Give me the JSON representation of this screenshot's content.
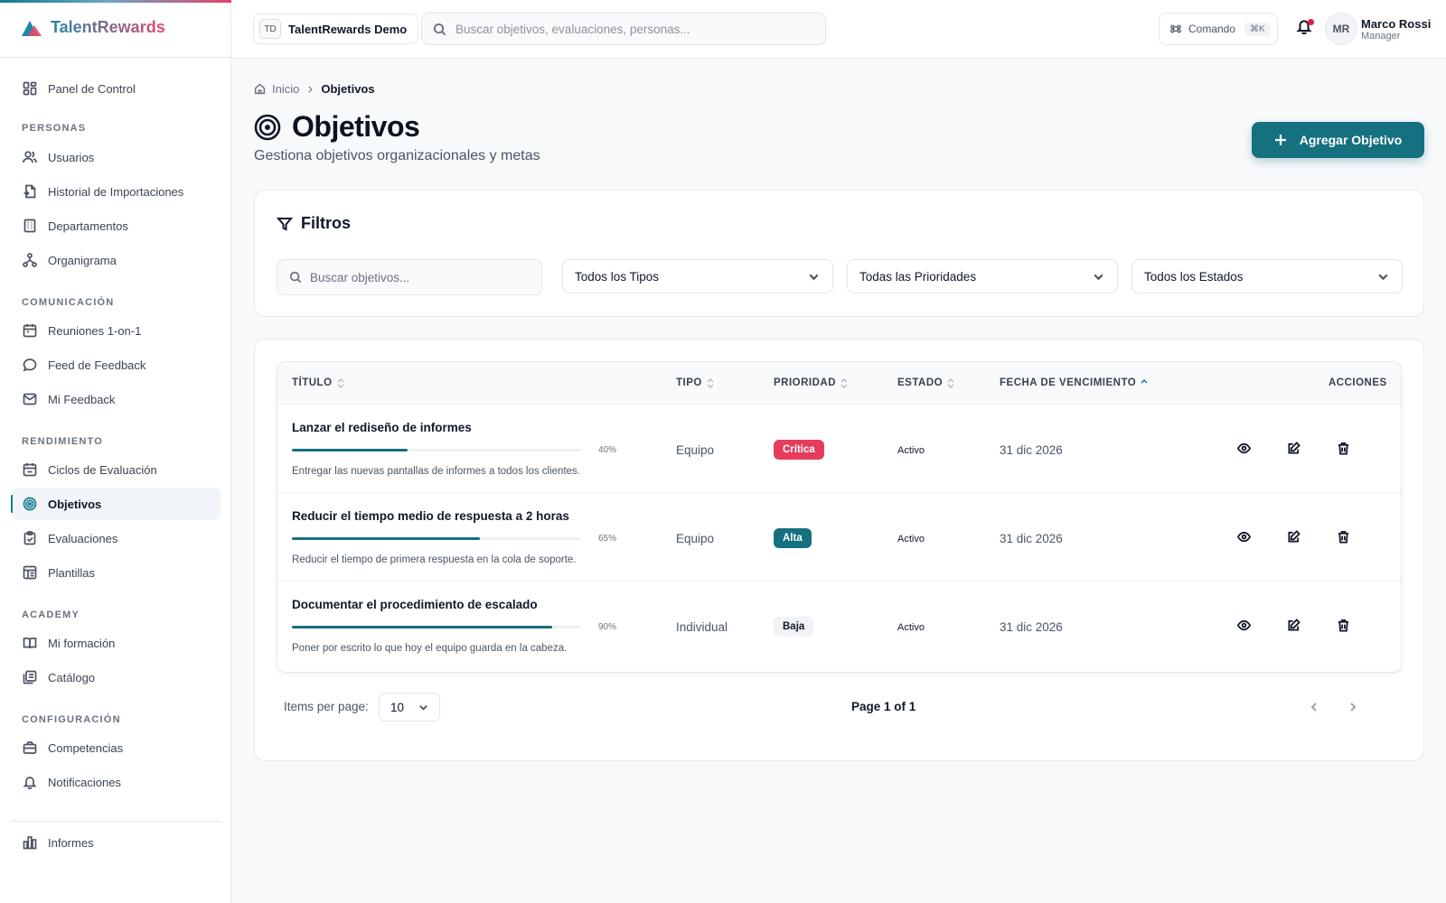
{
  "brand": {
    "name": "TalentRewards"
  },
  "header": {
    "org_badge": "TD",
    "org_name": "TalentRewards Demo",
    "search_placeholder": "Buscar objetivos, evaluaciones, personas...",
    "command_label": "Comando",
    "command_shortcut": "⌘K",
    "user_initials": "MR",
    "user_name": "Marco Rossi",
    "user_role": "Manager"
  },
  "sidebar": {
    "dashboard": "Panel de Control",
    "sections": {
      "personas": "PERSONAS",
      "comunicacion": "COMUNICACIÓN",
      "rendimiento": "RENDIMIENTO",
      "academy": "ACADEMY",
      "configuracion": "CONFIGURACIÓN"
    },
    "items": {
      "usuarios": "Usuarios",
      "historial": "Historial de Importaciones",
      "departamentos": "Departamentos",
      "organigrama": "Organigrama",
      "reuniones": "Reuniones 1-on-1",
      "feed": "Feed de Feedback",
      "mi_feedback": "Mi Feedback",
      "ciclos": "Ciclos de Evaluación",
      "objetivos": "Objetivos",
      "evaluaciones": "Evaluaciones",
      "plantillas": "Plantillas",
      "mi_formacion": "Mi formación",
      "catalogo": "Catálogo",
      "competencias": "Competencias",
      "notificaciones": "Notificaciones",
      "informes": "Informes"
    }
  },
  "breadcrumb": {
    "home": "Inicio",
    "current": "Objetivos"
  },
  "page": {
    "title": "Objetivos",
    "subtitle": "Gestiona objetivos organizacionales y metas",
    "add_button": "Agregar Objetivo"
  },
  "filters": {
    "title": "Filtros",
    "search_placeholder": "Buscar objetivos...",
    "type_select": "Todos los Tipos",
    "priority_select": "Todas las Prioridades",
    "status_select": "Todos los Estados"
  },
  "table": {
    "headers": {
      "title": "TÍTULO",
      "type": "TIPO",
      "priority": "PRIORIDAD",
      "status": "ESTADO",
      "due": "FECHA DE VENCIMIENTO",
      "actions": "ACCIONES"
    },
    "rows": [
      {
        "title": "Lanzar el rediseño de informes",
        "progress": 40,
        "progress_label": "40%",
        "description": "Entregar las nuevas pantallas de informes a todos los clientes.",
        "type": "Equipo",
        "priority": "Crítica",
        "status": "Activo",
        "due": "31 dic 2026"
      },
      {
        "title": "Reducir el tiempo medio de respuesta a 2 horas",
        "progress": 65,
        "progress_label": "65%",
        "description": "Reducir el tiempo de primera respuesta en la cola de soporte.",
        "type": "Equipo",
        "priority": "Alta",
        "status": "Activo",
        "due": "31 dic 2026"
      },
      {
        "title": "Documentar el procedimiento de escalado",
        "progress": 90,
        "progress_label": "90%",
        "description": "Poner por escrito lo que hoy el equipo guarda en la cabeza.",
        "type": "Individual",
        "priority": "Baja",
        "status": "Activo",
        "due": "31 dic 2026"
      }
    ]
  },
  "pagination": {
    "items_per_page_label": "Items per page:",
    "items_per_page": "10",
    "page_info": "Page 1 of 1"
  },
  "colors": {
    "accent": "#15707f",
    "critical": "#e63c5c",
    "brand_start": "#1f88a6",
    "brand_end": "#e24a6d"
  }
}
